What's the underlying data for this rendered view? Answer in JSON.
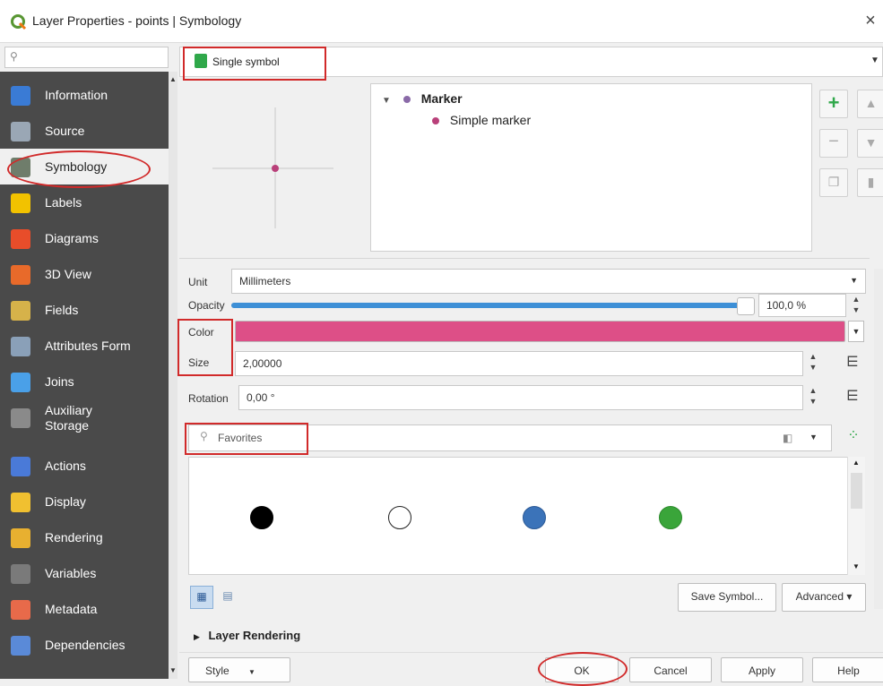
{
  "window": {
    "title": "Layer Properties - points | Symbology",
    "close_glyph": "×"
  },
  "search": {
    "placeholder": ""
  },
  "sidebar": {
    "items": [
      {
        "label": "Information",
        "icon": "info-icon",
        "color": "#3a7bd5"
      },
      {
        "label": "Source",
        "icon": "source-icon",
        "color": "#9aa7b5"
      },
      {
        "label": "Symbology",
        "icon": "symbology-icon",
        "color": "#6f7d6b",
        "active": true
      },
      {
        "label": "Labels",
        "icon": "labels-icon",
        "color": "#f2c200"
      },
      {
        "label": "Diagrams",
        "icon": "diagrams-icon",
        "color": "#e84d2a"
      },
      {
        "label": "3D View",
        "icon": "3d-view-icon",
        "color": "#e86a2a"
      },
      {
        "label": "Fields",
        "icon": "fields-icon",
        "color": "#d6b24a"
      },
      {
        "label": "Attributes Form",
        "icon": "attributes-form-icon",
        "color": "#8aa0b8"
      },
      {
        "label": "Joins",
        "icon": "joins-icon",
        "color": "#4aa0e8"
      },
      {
        "label": "Auxiliary\nStorage",
        "icon": "auxiliary-storage-icon",
        "color": "#8a8a8a"
      },
      {
        "label": "Actions",
        "icon": "actions-icon",
        "color": "#4a7ad8"
      },
      {
        "label": "Display",
        "icon": "display-icon",
        "color": "#f0c030"
      },
      {
        "label": "Rendering",
        "icon": "rendering-icon",
        "color": "#e8b030"
      },
      {
        "label": "Variables",
        "icon": "variables-icon",
        "color": "#7a7a7a"
      },
      {
        "label": "Metadata",
        "icon": "metadata-icon",
        "color": "#e86a4a"
      },
      {
        "label": "Dependencies",
        "icon": "dependencies-icon",
        "color": "#5a8ad8"
      }
    ]
  },
  "renderer": {
    "label": "Single symbol"
  },
  "symbol_tree": {
    "root": "Marker",
    "child": "Simple marker",
    "marker_color": "#b9407a"
  },
  "unit": {
    "label": "Unit",
    "value": "Millimeters"
  },
  "opacity": {
    "label": "Opacity",
    "value": "100,0 %",
    "fraction": 1.0
  },
  "color": {
    "label": "Color",
    "value": "#dd4f87"
  },
  "size": {
    "label": "Size",
    "value": "2,00000"
  },
  "rotation": {
    "label": "Rotation",
    "value": "0,00 °"
  },
  "favorites": {
    "placeholder": "Favorites"
  },
  "symbols": [
    {
      "name": "black-dot",
      "fill": "#000000",
      "stroke": "#000000"
    },
    {
      "name": "white-dot",
      "fill": "#ffffff",
      "stroke": "#222222"
    },
    {
      "name": "blue-dot",
      "fill": "#3b73b9",
      "stroke": "#2c5a96"
    },
    {
      "name": "green-dot",
      "fill": "#3aa53a",
      "stroke": "#2c8a2c"
    }
  ],
  "buttons": {
    "save_symbol": "Save Symbol...",
    "advanced": "Advanced ▾",
    "layer_rendering": "Layer Rendering",
    "style": "Style",
    "ok": "OK",
    "cancel": "Cancel",
    "apply": "Apply",
    "help": "Help"
  },
  "colors": {
    "highlight": "#d12a2a",
    "sidebar_bg": "#4a4a4a",
    "opacity_bar": "#3d8fd6"
  }
}
